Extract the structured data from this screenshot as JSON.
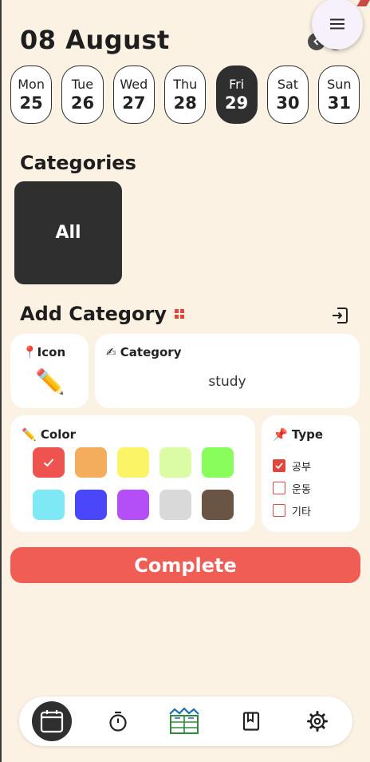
{
  "header": {
    "date_title": "08 August"
  },
  "week": [
    {
      "day": "Mon",
      "num": "25",
      "selected": false
    },
    {
      "day": "Tue",
      "num": "26",
      "selected": false
    },
    {
      "day": "Wed",
      "num": "27",
      "selected": false
    },
    {
      "day": "Thu",
      "num": "28",
      "selected": false
    },
    {
      "day": "Fri",
      "num": "29",
      "selected": true
    },
    {
      "day": "Sat",
      "num": "30",
      "selected": false
    },
    {
      "day": "Sun",
      "num": "31",
      "selected": false
    }
  ],
  "categories": {
    "title": "Categories",
    "items": [
      "All"
    ]
  },
  "add_category": {
    "title": "Add Category",
    "icon_label": "📍Icon",
    "icon_value": "✏️",
    "category_label": "✍ Category",
    "category_value": "study",
    "color_label": "✏️ Color",
    "colors": [
      "#ef5350",
      "#f3ad5c",
      "#fbf466",
      "#dbfba4",
      "#88fd5c",
      "#7ee8f4",
      "#4a46fa",
      "#b44ef6",
      "#d9d9d9",
      "#6a5443"
    ],
    "selected_color_index": 0,
    "type_label": "📌 Type",
    "types": [
      {
        "label": "공부",
        "checked": true
      },
      {
        "label": "운동",
        "checked": false
      },
      {
        "label": "기타",
        "checked": false
      }
    ]
  },
  "complete_button": "Complete",
  "theme": {
    "background": "#fbf2e3",
    "dark": "#2f2f2f",
    "accent": "#ef5d55"
  },
  "bottom_nav": [
    "calendar-icon",
    "timer-icon",
    "books-icon",
    "book-icon",
    "gear-icon"
  ]
}
